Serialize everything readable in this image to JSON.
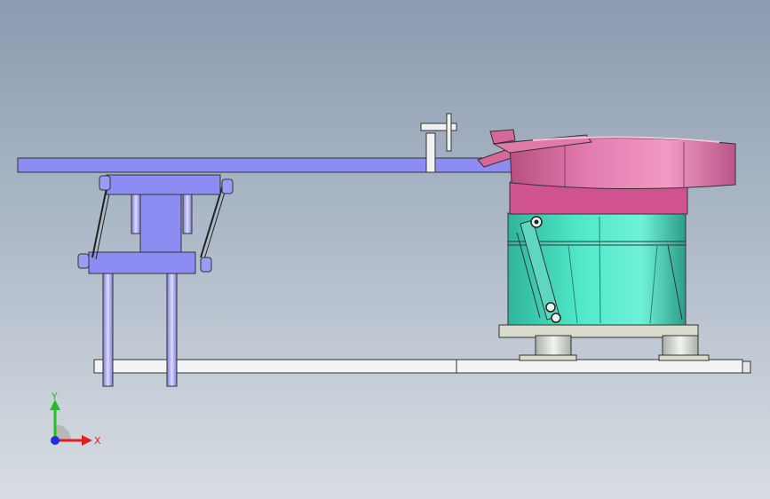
{
  "viewport": {
    "background_top": "#8a9bb0",
    "background_bottom": "#d8dde3"
  },
  "model": {
    "track_color": "#8c8cf2",
    "bowl_color": "#d6679a",
    "base_color": "#4fe8c8",
    "frame_color": "#f2f2f2"
  },
  "triad": {
    "x_label": "X",
    "y_label": "Y",
    "x_color": "#e02020",
    "y_color": "#20c020",
    "z_color": "#2030e0"
  }
}
